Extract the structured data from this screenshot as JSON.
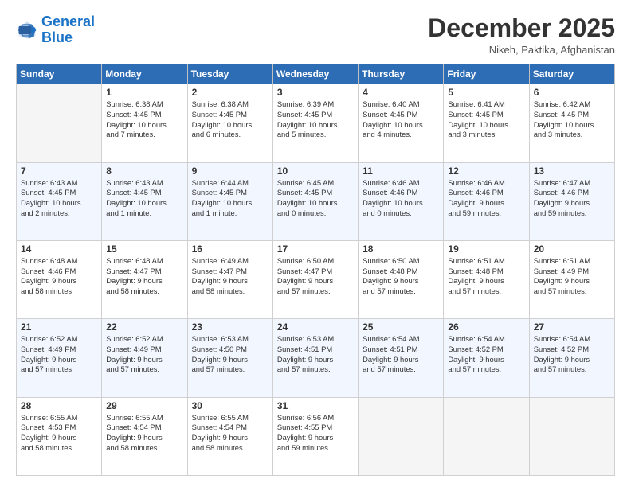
{
  "logo": {
    "text_general": "General",
    "text_blue": "Blue"
  },
  "header": {
    "month": "December 2025",
    "location": "Nikeh, Paktika, Afghanistan"
  },
  "weekdays": [
    "Sunday",
    "Monday",
    "Tuesday",
    "Wednesday",
    "Thursday",
    "Friday",
    "Saturday"
  ],
  "weeks": [
    [
      {
        "day": "",
        "lines": []
      },
      {
        "day": "1",
        "lines": [
          "Sunrise: 6:38 AM",
          "Sunset: 4:45 PM",
          "Daylight: 10 hours",
          "and 7 minutes."
        ]
      },
      {
        "day": "2",
        "lines": [
          "Sunrise: 6:38 AM",
          "Sunset: 4:45 PM",
          "Daylight: 10 hours",
          "and 6 minutes."
        ]
      },
      {
        "day": "3",
        "lines": [
          "Sunrise: 6:39 AM",
          "Sunset: 4:45 PM",
          "Daylight: 10 hours",
          "and 5 minutes."
        ]
      },
      {
        "day": "4",
        "lines": [
          "Sunrise: 6:40 AM",
          "Sunset: 4:45 PM",
          "Daylight: 10 hours",
          "and 4 minutes."
        ]
      },
      {
        "day": "5",
        "lines": [
          "Sunrise: 6:41 AM",
          "Sunset: 4:45 PM",
          "Daylight: 10 hours",
          "and 3 minutes."
        ]
      },
      {
        "day": "6",
        "lines": [
          "Sunrise: 6:42 AM",
          "Sunset: 4:45 PM",
          "Daylight: 10 hours",
          "and 3 minutes."
        ]
      }
    ],
    [
      {
        "day": "7",
        "lines": [
          "Sunrise: 6:43 AM",
          "Sunset: 4:45 PM",
          "Daylight: 10 hours",
          "and 2 minutes."
        ]
      },
      {
        "day": "8",
        "lines": [
          "Sunrise: 6:43 AM",
          "Sunset: 4:45 PM",
          "Daylight: 10 hours",
          "and 1 minute."
        ]
      },
      {
        "day": "9",
        "lines": [
          "Sunrise: 6:44 AM",
          "Sunset: 4:45 PM",
          "Daylight: 10 hours",
          "and 1 minute."
        ]
      },
      {
        "day": "10",
        "lines": [
          "Sunrise: 6:45 AM",
          "Sunset: 4:45 PM",
          "Daylight: 10 hours",
          "and 0 minutes."
        ]
      },
      {
        "day": "11",
        "lines": [
          "Sunrise: 6:46 AM",
          "Sunset: 4:46 PM",
          "Daylight: 10 hours",
          "and 0 minutes."
        ]
      },
      {
        "day": "12",
        "lines": [
          "Sunrise: 6:46 AM",
          "Sunset: 4:46 PM",
          "Daylight: 9 hours",
          "and 59 minutes."
        ]
      },
      {
        "day": "13",
        "lines": [
          "Sunrise: 6:47 AM",
          "Sunset: 4:46 PM",
          "Daylight: 9 hours",
          "and 59 minutes."
        ]
      }
    ],
    [
      {
        "day": "14",
        "lines": [
          "Sunrise: 6:48 AM",
          "Sunset: 4:46 PM",
          "Daylight: 9 hours",
          "and 58 minutes."
        ]
      },
      {
        "day": "15",
        "lines": [
          "Sunrise: 6:48 AM",
          "Sunset: 4:47 PM",
          "Daylight: 9 hours",
          "and 58 minutes."
        ]
      },
      {
        "day": "16",
        "lines": [
          "Sunrise: 6:49 AM",
          "Sunset: 4:47 PM",
          "Daylight: 9 hours",
          "and 58 minutes."
        ]
      },
      {
        "day": "17",
        "lines": [
          "Sunrise: 6:50 AM",
          "Sunset: 4:47 PM",
          "Daylight: 9 hours",
          "and 57 minutes."
        ]
      },
      {
        "day": "18",
        "lines": [
          "Sunrise: 6:50 AM",
          "Sunset: 4:48 PM",
          "Daylight: 9 hours",
          "and 57 minutes."
        ]
      },
      {
        "day": "19",
        "lines": [
          "Sunrise: 6:51 AM",
          "Sunset: 4:48 PM",
          "Daylight: 9 hours",
          "and 57 minutes."
        ]
      },
      {
        "day": "20",
        "lines": [
          "Sunrise: 6:51 AM",
          "Sunset: 4:49 PM",
          "Daylight: 9 hours",
          "and 57 minutes."
        ]
      }
    ],
    [
      {
        "day": "21",
        "lines": [
          "Sunrise: 6:52 AM",
          "Sunset: 4:49 PM",
          "Daylight: 9 hours",
          "and 57 minutes."
        ]
      },
      {
        "day": "22",
        "lines": [
          "Sunrise: 6:52 AM",
          "Sunset: 4:49 PM",
          "Daylight: 9 hours",
          "and 57 minutes."
        ]
      },
      {
        "day": "23",
        "lines": [
          "Sunrise: 6:53 AM",
          "Sunset: 4:50 PM",
          "Daylight: 9 hours",
          "and 57 minutes."
        ]
      },
      {
        "day": "24",
        "lines": [
          "Sunrise: 6:53 AM",
          "Sunset: 4:51 PM",
          "Daylight: 9 hours",
          "and 57 minutes."
        ]
      },
      {
        "day": "25",
        "lines": [
          "Sunrise: 6:54 AM",
          "Sunset: 4:51 PM",
          "Daylight: 9 hours",
          "and 57 minutes."
        ]
      },
      {
        "day": "26",
        "lines": [
          "Sunrise: 6:54 AM",
          "Sunset: 4:52 PM",
          "Daylight: 9 hours",
          "and 57 minutes."
        ]
      },
      {
        "day": "27",
        "lines": [
          "Sunrise: 6:54 AM",
          "Sunset: 4:52 PM",
          "Daylight: 9 hours",
          "and 57 minutes."
        ]
      }
    ],
    [
      {
        "day": "28",
        "lines": [
          "Sunrise: 6:55 AM",
          "Sunset: 4:53 PM",
          "Daylight: 9 hours",
          "and 58 minutes."
        ]
      },
      {
        "day": "29",
        "lines": [
          "Sunrise: 6:55 AM",
          "Sunset: 4:54 PM",
          "Daylight: 9 hours",
          "and 58 minutes."
        ]
      },
      {
        "day": "30",
        "lines": [
          "Sunrise: 6:55 AM",
          "Sunset: 4:54 PM",
          "Daylight: 9 hours",
          "and 58 minutes."
        ]
      },
      {
        "day": "31",
        "lines": [
          "Sunrise: 6:56 AM",
          "Sunset: 4:55 PM",
          "Daylight: 9 hours",
          "and 59 minutes."
        ]
      },
      {
        "day": "",
        "lines": []
      },
      {
        "day": "",
        "lines": []
      },
      {
        "day": "",
        "lines": []
      }
    ]
  ]
}
